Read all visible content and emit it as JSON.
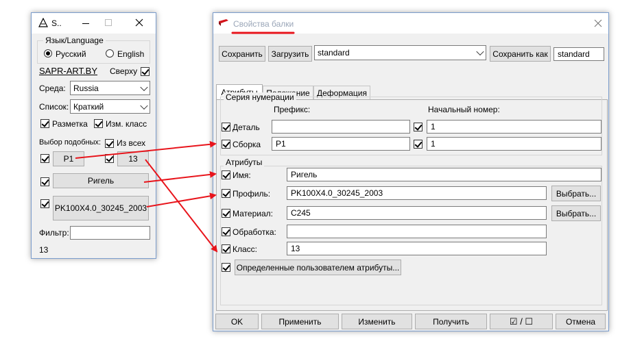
{
  "small_window": {
    "title": "S..",
    "language_group": "Язык/Language",
    "lang_ru": "Русский",
    "lang_en": "English",
    "link": "SAPR-ART.BY",
    "on_top": "Сверху",
    "env_label": "Среда:",
    "env_value": "Russia",
    "list_label": "Список:",
    "list_value": "Краткий",
    "markup": "Разметка",
    "change_class": "Изм. класс",
    "select_similar": "Выбор подобных:",
    "from_all": "Из всех",
    "btn_p1": "P1",
    "btn_13": "13",
    "btn_rigel": "Ригель",
    "btn_profile": "PK100X4.0_30245_2003",
    "filter_label": "Фильтр:",
    "count": "13"
  },
  "main_window": {
    "title": "Свойства балки",
    "save": "Сохранить",
    "load": "Загрузить",
    "preset": "standard",
    "save_as": "Сохранить как",
    "save_as_value": "standard",
    "tabs": [
      "Атрибуты",
      "Положение",
      "Деформация"
    ],
    "numbering_group": "Серия нумерации",
    "prefix": "Префикс:",
    "start_number": "Начальный номер:",
    "detail": "Деталь",
    "detail_start": "1",
    "assembly": "Сборка",
    "assembly_prefix": "P1",
    "assembly_start": "1",
    "attributes_group": "Атрибуты",
    "name_label": "Имя:",
    "name_value": "Ригель",
    "profile_label": "Профиль:",
    "profile_value": "PK100X4.0_30245_2003",
    "select_btn": "Выбрать...",
    "material_label": "Материал:",
    "material_value": "C245",
    "finish_label": "Обработка:",
    "class_label": "Класс:",
    "class_value": "13",
    "user_attrs": "Определенные пользователем атрибуты...",
    "ok": "OK",
    "apply": "Применить",
    "modify": "Изменить",
    "get": "Получить",
    "toggle": "☑ / ☐",
    "cancel": "Отмена"
  },
  "colors": {
    "annotation": "#e8141b",
    "window_bg": "#f0f0f0",
    "title_text": "#9aa6b8"
  }
}
